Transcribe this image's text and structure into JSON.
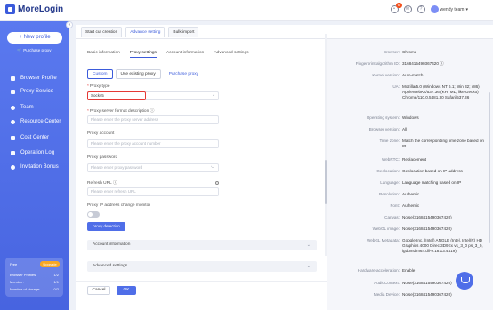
{
  "app": {
    "name": "MoreLogin"
  },
  "header": {
    "notification_count": "6",
    "user_name": "wendy team"
  },
  "sidebar": {
    "new_profile": "+ New profile",
    "purchase_proxy": "Purchase proxy",
    "collapse_glyph": "«",
    "items": [
      {
        "label": "Browser Profile",
        "icon": "browser-icon"
      },
      {
        "label": "Proxy Service",
        "icon": "proxy-icon"
      },
      {
        "label": "Team",
        "icon": "team-icon"
      },
      {
        "label": "Resource Center",
        "icon": "resource-icon"
      },
      {
        "label": "Cost Center",
        "icon": "cost-icon"
      },
      {
        "label": "Operation Log",
        "icon": "log-icon"
      },
      {
        "label": "Invitation Bonus",
        "icon": "gift-icon"
      }
    ],
    "plan": {
      "name": "Free",
      "upgrade": "Upgrade",
      "rows": [
        {
          "label": "Browser Profiles:",
          "value": "1/2"
        },
        {
          "label": "Member:",
          "value": "1/1"
        },
        {
          "label": "Number of storage:",
          "value": "0/2"
        }
      ]
    }
  },
  "top_tabs": [
    "Start cut creation",
    "Advance setting",
    "Bulk import"
  ],
  "sub_tabs": [
    "Basic information",
    "Proxy settings",
    "Account information",
    "Advanced settings"
  ],
  "form": {
    "proxy_method": {
      "options": [
        "Custom",
        "Use existing proxy",
        "Purchase proxy"
      ]
    },
    "proxy_type": {
      "label": "Proxy type",
      "value": "Socks5"
    },
    "proxy_desc": {
      "label": "Proxy server format description",
      "placeholder": "Please enter the proxy server address"
    },
    "proxy_account": {
      "label": "Proxy account",
      "placeholder": "Please enter the proxy account number"
    },
    "proxy_password": {
      "label": "Proxy password",
      "placeholder": "Please enter proxy password"
    },
    "refresh_url": {
      "label": "Refresh URL",
      "placeholder": "Please enter refresh URL"
    },
    "ip_monitor": {
      "label": "Proxy IP address change monitor"
    },
    "proxy_detection": "proxy detection",
    "sections": [
      "Account information",
      "Advanced settings"
    ],
    "cancel": "Cancel",
    "ok": "OK"
  },
  "fingerprint": [
    {
      "k": "Browser:",
      "v": "Chrome"
    },
    {
      "k": "Fingerprint algorithm ID:",
      "v": "3168415490367420 ⓘ"
    },
    {
      "k": "Kernel version:",
      "v": "Auto-match"
    },
    {
      "k": "UA:",
      "v": "Mozilla/5.0 (Windows NT 6.1; Win 32; x86) AppleWebKit/537.36 (KHTML, like Gecko) Chrome/110.0.5481.30 Safari/537.36"
    },
    {
      "k": "Operating system:",
      "v": "Windows"
    },
    {
      "k": "Browser version:",
      "v": "All"
    },
    {
      "k": "Time zone:",
      "v": "Match the corresponding time zone based on IP"
    },
    {
      "k": "WebRTC:",
      "v": "Replacement"
    },
    {
      "k": "Geolocation:",
      "v": "Geolocation based on IP address"
    },
    {
      "k": "Language:",
      "v": "Language matching based on IP"
    },
    {
      "k": "Resolution:",
      "v": "Authentic"
    },
    {
      "k": "Font:",
      "v": "Authentic"
    },
    {
      "k": "Canvas:",
      "v": "Noise(3168415490367420)"
    },
    {
      "k": "WebGL image:",
      "v": "Noise(3168415490367420)"
    },
    {
      "k": "WebGL Metadata:",
      "v": "Google Inc. (Intel) ANGLE (Intel, Intel(R) HD Graphics 4000 Direct3D9Ex vs_3_0 ps_3_0, igdumdim64.dll-9.18.13.4419)"
    },
    {
      "k": "Hardware acceleration:",
      "v": "Enable"
    },
    {
      "k": "AudioContext:",
      "v": "Noise(3168415490367420)"
    },
    {
      "k": "Media Device:",
      "v": "Noise(3168415490367420)"
    }
  ]
}
